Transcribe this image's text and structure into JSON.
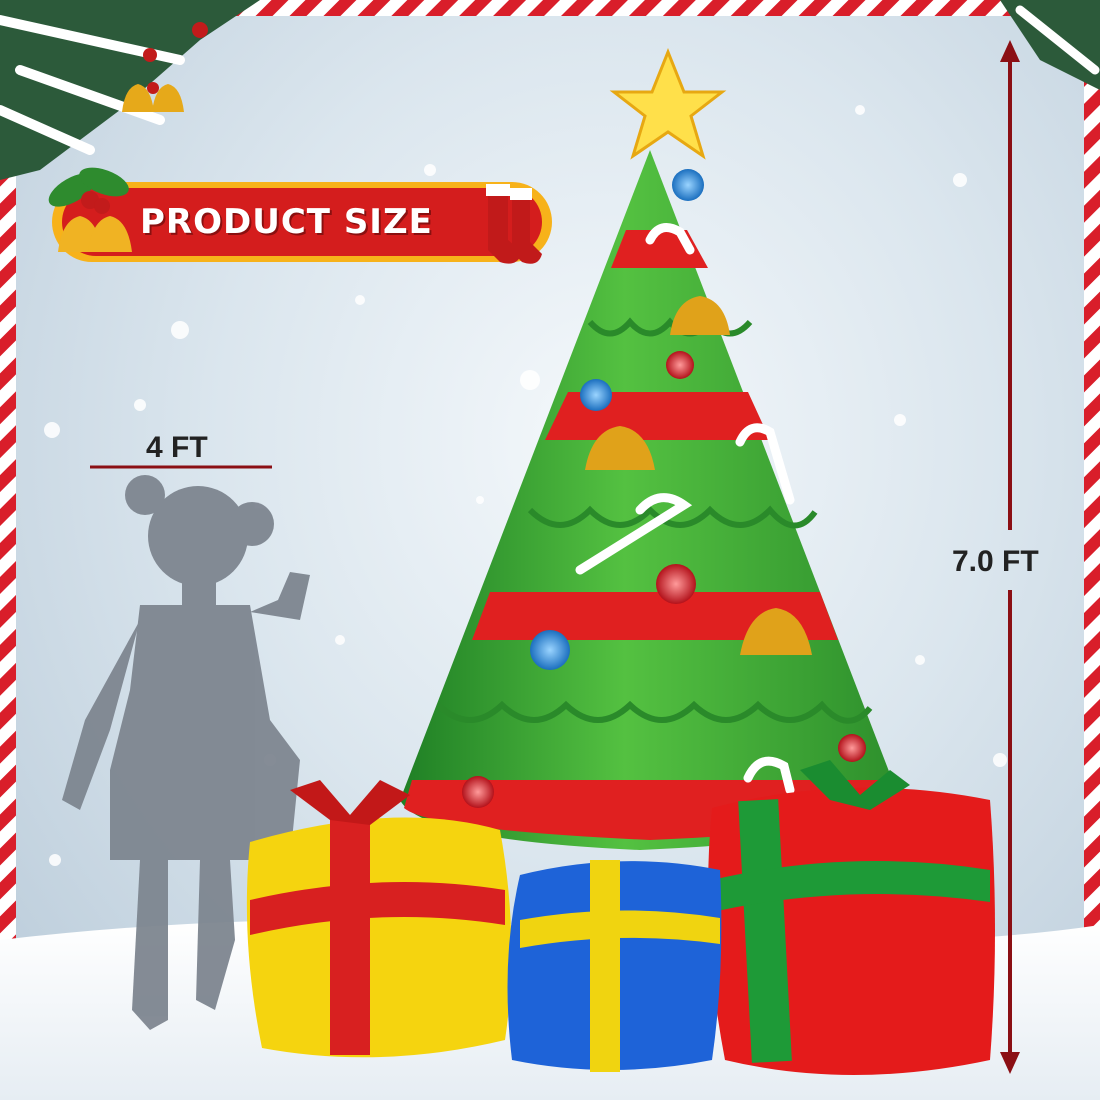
{
  "banner": {
    "label": "PRODUCT SIZE"
  },
  "dimensions": {
    "child_height": "4 FT",
    "tree_height": "7.0 FT"
  },
  "colors": {
    "border_red": "#d91e2a",
    "tree_green": "#3aa635",
    "ribbon_red": "#e02020",
    "gift_yellow": "#f5d40f",
    "gift_blue": "#1e63d8",
    "gift_red": "#e41b1b",
    "star_yellow": "#ffe04a",
    "silhouette_gray": "#7e8690"
  },
  "icons": [
    "christmas-star-icon",
    "bell-icon",
    "holly-icon",
    "stocking-icon",
    "candy-cane-icon",
    "ornament-icon"
  ]
}
